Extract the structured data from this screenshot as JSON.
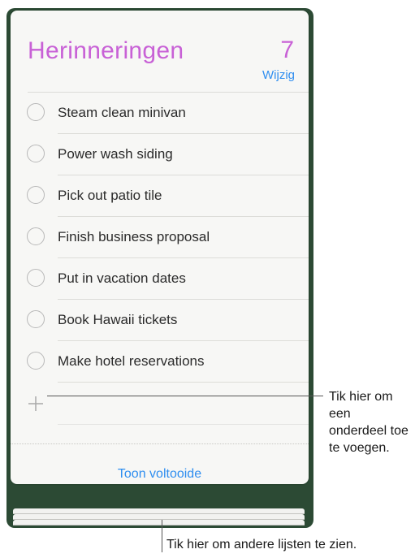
{
  "header": {
    "title": "Herinneringen",
    "count": "7",
    "edit_label": "Wijzig"
  },
  "reminders": [
    {
      "label": "Steam clean minivan"
    },
    {
      "label": "Power wash siding"
    },
    {
      "label": "Pick out patio tile"
    },
    {
      "label": "Finish business proposal"
    },
    {
      "label": "Put in vacation dates"
    },
    {
      "label": "Book Hawaii tickets"
    },
    {
      "label": "Make hotel reservations"
    }
  ],
  "footer": {
    "show_completed_label": "Toon voltooide"
  },
  "callouts": {
    "add_item": "Tik hier om een onderdeel toe te voegen.",
    "other_lists": "Tik hier om andere lijsten te zien."
  },
  "colors": {
    "title": "#c861d6",
    "link": "#2f8ef0"
  },
  "icons": {
    "add": "plus-icon",
    "checkbox": "circle-checkbox-icon"
  }
}
